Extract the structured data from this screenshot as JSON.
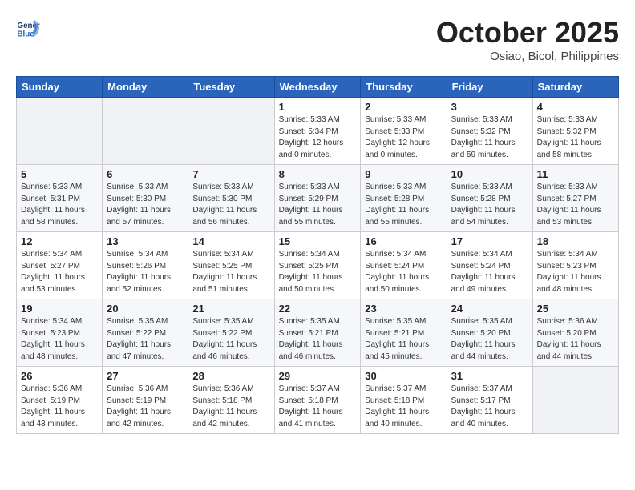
{
  "header": {
    "logo_general": "General",
    "logo_blue": "Blue",
    "month": "October 2025",
    "location": "Osiao, Bicol, Philippines"
  },
  "weekdays": [
    "Sunday",
    "Monday",
    "Tuesday",
    "Wednesday",
    "Thursday",
    "Friday",
    "Saturday"
  ],
  "weeks": [
    [
      {
        "day": "",
        "info": ""
      },
      {
        "day": "",
        "info": ""
      },
      {
        "day": "",
        "info": ""
      },
      {
        "day": "1",
        "info": "Sunrise: 5:33 AM\nSunset: 5:34 PM\nDaylight: 12 hours\nand 0 minutes."
      },
      {
        "day": "2",
        "info": "Sunrise: 5:33 AM\nSunset: 5:33 PM\nDaylight: 12 hours\nand 0 minutes."
      },
      {
        "day": "3",
        "info": "Sunrise: 5:33 AM\nSunset: 5:32 PM\nDaylight: 11 hours\nand 59 minutes."
      },
      {
        "day": "4",
        "info": "Sunrise: 5:33 AM\nSunset: 5:32 PM\nDaylight: 11 hours\nand 58 minutes."
      }
    ],
    [
      {
        "day": "5",
        "info": "Sunrise: 5:33 AM\nSunset: 5:31 PM\nDaylight: 11 hours\nand 58 minutes."
      },
      {
        "day": "6",
        "info": "Sunrise: 5:33 AM\nSunset: 5:30 PM\nDaylight: 11 hours\nand 57 minutes."
      },
      {
        "day": "7",
        "info": "Sunrise: 5:33 AM\nSunset: 5:30 PM\nDaylight: 11 hours\nand 56 minutes."
      },
      {
        "day": "8",
        "info": "Sunrise: 5:33 AM\nSunset: 5:29 PM\nDaylight: 11 hours\nand 55 minutes."
      },
      {
        "day": "9",
        "info": "Sunrise: 5:33 AM\nSunset: 5:28 PM\nDaylight: 11 hours\nand 55 minutes."
      },
      {
        "day": "10",
        "info": "Sunrise: 5:33 AM\nSunset: 5:28 PM\nDaylight: 11 hours\nand 54 minutes."
      },
      {
        "day": "11",
        "info": "Sunrise: 5:33 AM\nSunset: 5:27 PM\nDaylight: 11 hours\nand 53 minutes."
      }
    ],
    [
      {
        "day": "12",
        "info": "Sunrise: 5:34 AM\nSunset: 5:27 PM\nDaylight: 11 hours\nand 53 minutes."
      },
      {
        "day": "13",
        "info": "Sunrise: 5:34 AM\nSunset: 5:26 PM\nDaylight: 11 hours\nand 52 minutes."
      },
      {
        "day": "14",
        "info": "Sunrise: 5:34 AM\nSunset: 5:25 PM\nDaylight: 11 hours\nand 51 minutes."
      },
      {
        "day": "15",
        "info": "Sunrise: 5:34 AM\nSunset: 5:25 PM\nDaylight: 11 hours\nand 50 minutes."
      },
      {
        "day": "16",
        "info": "Sunrise: 5:34 AM\nSunset: 5:24 PM\nDaylight: 11 hours\nand 50 minutes."
      },
      {
        "day": "17",
        "info": "Sunrise: 5:34 AM\nSunset: 5:24 PM\nDaylight: 11 hours\nand 49 minutes."
      },
      {
        "day": "18",
        "info": "Sunrise: 5:34 AM\nSunset: 5:23 PM\nDaylight: 11 hours\nand 48 minutes."
      }
    ],
    [
      {
        "day": "19",
        "info": "Sunrise: 5:34 AM\nSunset: 5:23 PM\nDaylight: 11 hours\nand 48 minutes."
      },
      {
        "day": "20",
        "info": "Sunrise: 5:35 AM\nSunset: 5:22 PM\nDaylight: 11 hours\nand 47 minutes."
      },
      {
        "day": "21",
        "info": "Sunrise: 5:35 AM\nSunset: 5:22 PM\nDaylight: 11 hours\nand 46 minutes."
      },
      {
        "day": "22",
        "info": "Sunrise: 5:35 AM\nSunset: 5:21 PM\nDaylight: 11 hours\nand 46 minutes."
      },
      {
        "day": "23",
        "info": "Sunrise: 5:35 AM\nSunset: 5:21 PM\nDaylight: 11 hours\nand 45 minutes."
      },
      {
        "day": "24",
        "info": "Sunrise: 5:35 AM\nSunset: 5:20 PM\nDaylight: 11 hours\nand 44 minutes."
      },
      {
        "day": "25",
        "info": "Sunrise: 5:36 AM\nSunset: 5:20 PM\nDaylight: 11 hours\nand 44 minutes."
      }
    ],
    [
      {
        "day": "26",
        "info": "Sunrise: 5:36 AM\nSunset: 5:19 PM\nDaylight: 11 hours\nand 43 minutes."
      },
      {
        "day": "27",
        "info": "Sunrise: 5:36 AM\nSunset: 5:19 PM\nDaylight: 11 hours\nand 42 minutes."
      },
      {
        "day": "28",
        "info": "Sunrise: 5:36 AM\nSunset: 5:18 PM\nDaylight: 11 hours\nand 42 minutes."
      },
      {
        "day": "29",
        "info": "Sunrise: 5:37 AM\nSunset: 5:18 PM\nDaylight: 11 hours\nand 41 minutes."
      },
      {
        "day": "30",
        "info": "Sunrise: 5:37 AM\nSunset: 5:18 PM\nDaylight: 11 hours\nand 40 minutes."
      },
      {
        "day": "31",
        "info": "Sunrise: 5:37 AM\nSunset: 5:17 PM\nDaylight: 11 hours\nand 40 minutes."
      },
      {
        "day": "",
        "info": ""
      }
    ]
  ]
}
